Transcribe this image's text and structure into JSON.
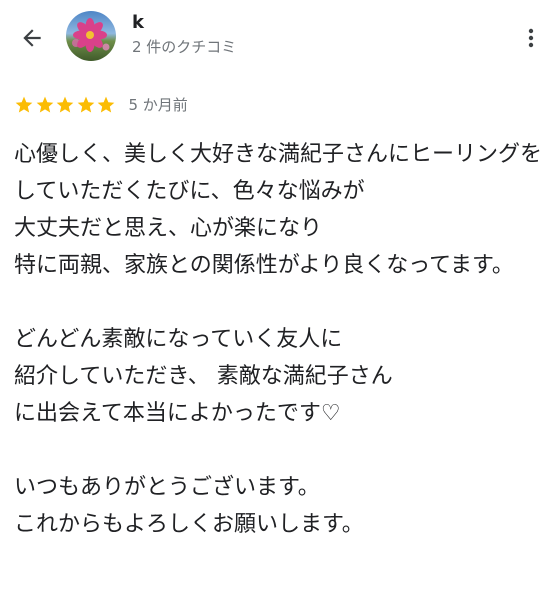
{
  "header": {
    "back_icon": "arrow-back-icon",
    "user_name": "k",
    "review_count": "2 件のクチコミ",
    "menu_icon": "more-vert-icon"
  },
  "review": {
    "rating": 5,
    "max_rating": 5,
    "star_color": "#fbbc04",
    "date": "5 か月前",
    "text": "心優しく、美しく大好きな満紀子さんにヒーリングを\nしていただくたびに、色々な悩みが\n大丈夫だと思え、心が楽になり\n特に両親、家族との関係性がより良くなってます。\n\nどんどん素敵になっていく友人に\n紹介していただき、 素敵な満紀子さん\nに出会えて本当によかったです♡\n\nいつもありがとうございます。\nこれからもよろしくお願いします。"
  }
}
